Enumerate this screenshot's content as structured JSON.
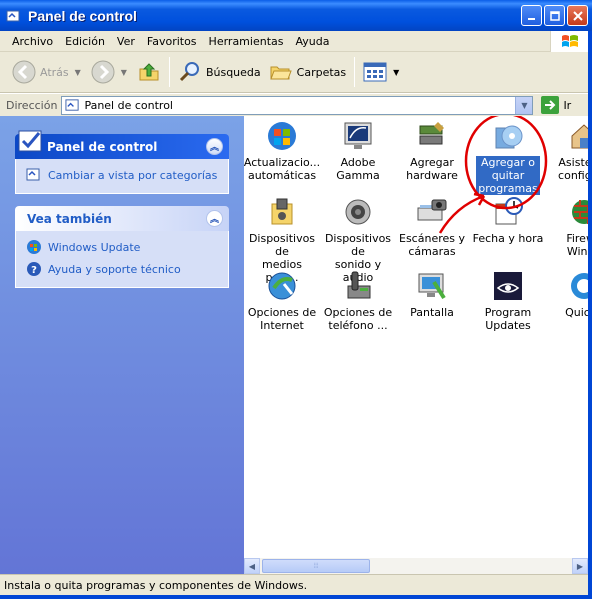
{
  "window": {
    "title": "Panel de control"
  },
  "menu": [
    "Archivo",
    "Edición",
    "Ver",
    "Favoritos",
    "Herramientas",
    "Ayuda"
  ],
  "toolbar": {
    "back": "Atrás",
    "search": "Búsqueda",
    "folders": "Carpetas"
  },
  "address": {
    "label": "Dirección",
    "value": "Panel de control",
    "go": "Ir"
  },
  "tasks": {
    "panel_title": "Panel de control",
    "switch_view": "Cambiar a vista por categorías",
    "see_also_title": "Vea también",
    "windows_update": "Windows Update",
    "help_support": "Ayuda y soporte técnico"
  },
  "items": [
    {
      "label1": "Actualizacio...",
      "label2": "automáticas",
      "icon": "automatic-updates-icon"
    },
    {
      "label1": "Adobe Gamma",
      "label2": "",
      "icon": "adobe-gamma-icon"
    },
    {
      "label1": "Agregar",
      "label2": "hardware",
      "icon": "add-hardware-icon"
    },
    {
      "label1": "Agregar o",
      "label2": "quitar",
      "label3": "programas",
      "icon": "add-remove-programs-icon",
      "selected": true
    },
    {
      "label1": "Asistente",
      "label2": "configura",
      "icon": "network-setup-icon"
    },
    {
      "label1": "Dispositivos de",
      "label2": "medios port...",
      "icon": "portable-media-icon"
    },
    {
      "label1": "Dispositivos de",
      "label2": "sonido y audio",
      "icon": "sound-audio-icon"
    },
    {
      "label1": "Escáneres y",
      "label2": "cámaras",
      "icon": "scanners-cameras-icon"
    },
    {
      "label1": "Fecha y hora",
      "label2": "",
      "icon": "date-time-icon"
    },
    {
      "label1": "Firewa",
      "label2": "Windo",
      "icon": "firewall-icon"
    },
    {
      "label1": "Opciones de",
      "label2": "Internet",
      "icon": "internet-options-icon"
    },
    {
      "label1": "Opciones de",
      "label2": "teléfono ...",
      "icon": "phone-options-icon"
    },
    {
      "label1": "Pantalla",
      "label2": "",
      "icon": "display-icon"
    },
    {
      "label1": "Program",
      "label2": "Updates",
      "icon": "program-updates-icon"
    },
    {
      "label1": "QuickT",
      "label2": "",
      "icon": "quicktime-icon"
    }
  ],
  "status": {
    "text": "Instala o quita programas y componentes de Windows."
  },
  "colors": {
    "xp_blue": "#0a5ae0",
    "selection": "#316ac5",
    "annotation_red": "#e00000",
    "task_link": "#215dc6"
  }
}
